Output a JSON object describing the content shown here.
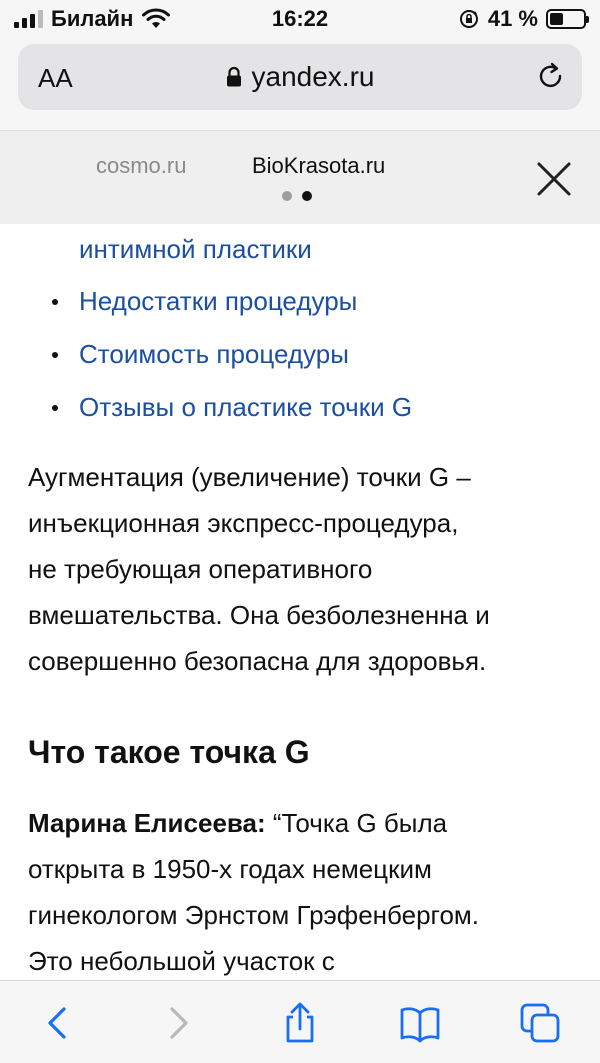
{
  "status_bar": {
    "carrier": "Билайн",
    "time": "16:22",
    "battery": "41 %",
    "battery_level": 0.41
  },
  "url_bar": {
    "text_size_label": "AA",
    "url": "yandex.ru"
  },
  "carousel": {
    "items": [
      "cosmo.ru",
      "BioKrasota.ru"
    ],
    "active_index": 1
  },
  "article": {
    "toc_partial": "интимной пластики",
    "toc": [
      "Недостатки процедуры",
      "Стоимость процедуры",
      "Отзывы о пластике точки G"
    ],
    "intro_lines": [
      "Аугментация (увеличение) точки G –",
      "инъекционная экспресс-процедура,",
      "не требующая оперативного",
      "вмешательства. Она безболезненна и",
      "совершенно безопасна для здоровья."
    ],
    "heading": "Что такое точка G",
    "quote_author": "Марина Елисеева:",
    "quote_first": " “Точка G была",
    "quote_lines": [
      "открыта в 1950-х годах немецким",
      "гинекологом Эрнстом Грэфенбергом.",
      "Это небольшой участок с"
    ]
  },
  "toolbar": {
    "icons": [
      "chevron-left-icon",
      "chevron-right-icon",
      "share-icon",
      "book-icon",
      "tabs-icon"
    ],
    "accent": "#1a6ef5"
  }
}
